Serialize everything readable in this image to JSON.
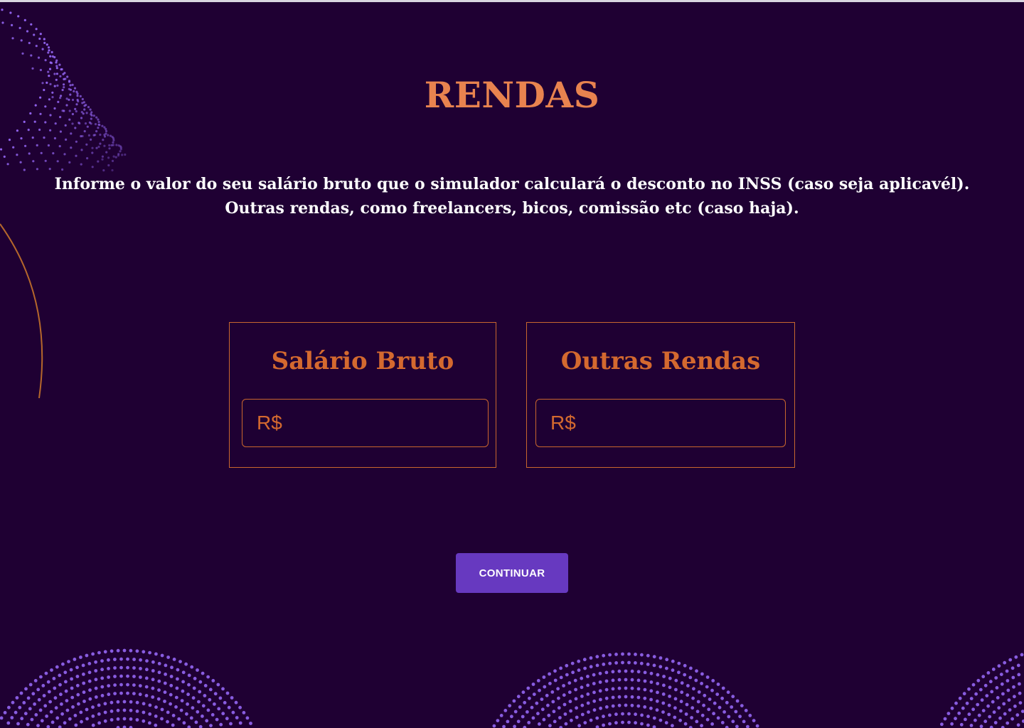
{
  "page": {
    "title": "RENDAS",
    "intro_line1": "Informe o valor do seu salário bruto que o simulador calculará o desconto no INSS (caso seja aplicavél).",
    "intro_line2": "Outras rendas, como freelancers, bicos, comissão etc (caso haja)."
  },
  "cards": {
    "salario": {
      "title": "Salário Bruto",
      "placeholder": "R$",
      "value": ""
    },
    "outras": {
      "title": "Outras Rendas",
      "placeholder": "R$",
      "value": ""
    }
  },
  "actions": {
    "continue_label": "CONTINUAR"
  },
  "colors": {
    "background": "#1f0033",
    "accent_orange": "#e8834f",
    "button_purple": "#6739c0",
    "dot_purple": "#9b6cff"
  }
}
